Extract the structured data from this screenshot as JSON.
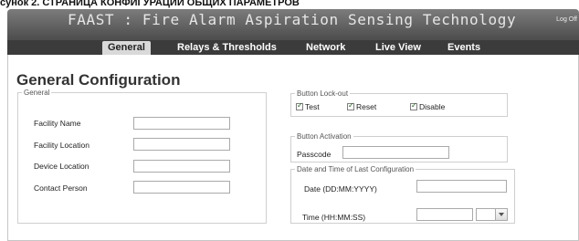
{
  "caption": "сунок 2. СТРАНИЦА КОНФИГУРАЦИИ ОБЩИХ ПАРАМЕТРОВ",
  "app": {
    "title": "FAAST : Fire Alarm Aspiration Sensing Technology",
    "logoff": "Log Off"
  },
  "nav": {
    "tabs": [
      {
        "label": "General"
      },
      {
        "label": "Relays & Thresholds"
      },
      {
        "label": "Network"
      },
      {
        "label": "Live View"
      },
      {
        "label": "Events"
      }
    ]
  },
  "page": {
    "title": "General Configuration"
  },
  "general": {
    "legend": "General",
    "facility_name": {
      "label": "Facility Name",
      "value": ""
    },
    "facility_location": {
      "label": "Facility Location",
      "value": ""
    },
    "device_location": {
      "label": "Device Location",
      "value": ""
    },
    "contact_person": {
      "label": "Contact Person",
      "value": ""
    }
  },
  "lockout": {
    "legend": "Button Lock-out",
    "test": {
      "label": "Test",
      "checked": true
    },
    "reset": {
      "label": "Reset",
      "checked": true
    },
    "disable": {
      "label": "Disable",
      "checked": true
    }
  },
  "activation": {
    "legend": "Button Activation",
    "passcode": {
      "label": "Passcode",
      "value": ""
    }
  },
  "last_config": {
    "legend": "Date and Time of Last Configuration",
    "date": {
      "label": "Date (DD:MM:YYYY)",
      "value": ""
    },
    "time": {
      "label": "Time (HH:MM:SS)",
      "value": ""
    }
  }
}
